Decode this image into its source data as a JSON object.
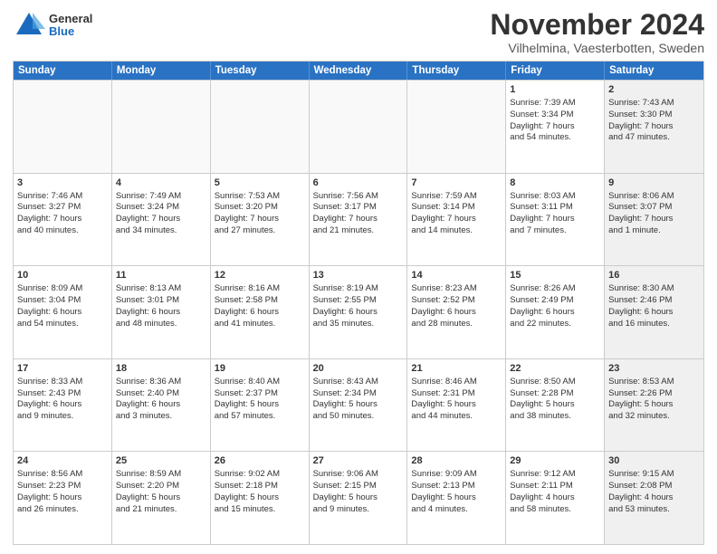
{
  "logo": {
    "general": "General",
    "blue": "Blue"
  },
  "header": {
    "month": "November 2024",
    "location": "Vilhelmina, Vaesterbotten, Sweden"
  },
  "days": [
    "Sunday",
    "Monday",
    "Tuesday",
    "Wednesday",
    "Thursday",
    "Friday",
    "Saturday"
  ],
  "rows": [
    [
      {
        "day": "",
        "empty": true
      },
      {
        "day": "",
        "empty": true
      },
      {
        "day": "",
        "empty": true
      },
      {
        "day": "",
        "empty": true
      },
      {
        "day": "",
        "empty": true
      },
      {
        "day": "1",
        "lines": [
          "Sunrise: 7:39 AM",
          "Sunset: 3:34 PM",
          "Daylight: 7 hours",
          "and 54 minutes."
        ]
      },
      {
        "day": "2",
        "shaded": true,
        "lines": [
          "Sunrise: 7:43 AM",
          "Sunset: 3:30 PM",
          "Daylight: 7 hours",
          "and 47 minutes."
        ]
      }
    ],
    [
      {
        "day": "3",
        "lines": [
          "Sunrise: 7:46 AM",
          "Sunset: 3:27 PM",
          "Daylight: 7 hours",
          "and 40 minutes."
        ]
      },
      {
        "day": "4",
        "lines": [
          "Sunrise: 7:49 AM",
          "Sunset: 3:24 PM",
          "Daylight: 7 hours",
          "and 34 minutes."
        ]
      },
      {
        "day": "5",
        "lines": [
          "Sunrise: 7:53 AM",
          "Sunset: 3:20 PM",
          "Daylight: 7 hours",
          "and 27 minutes."
        ]
      },
      {
        "day": "6",
        "lines": [
          "Sunrise: 7:56 AM",
          "Sunset: 3:17 PM",
          "Daylight: 7 hours",
          "and 21 minutes."
        ]
      },
      {
        "day": "7",
        "lines": [
          "Sunrise: 7:59 AM",
          "Sunset: 3:14 PM",
          "Daylight: 7 hours",
          "and 14 minutes."
        ]
      },
      {
        "day": "8",
        "lines": [
          "Sunrise: 8:03 AM",
          "Sunset: 3:11 PM",
          "Daylight: 7 hours",
          "and 7 minutes."
        ]
      },
      {
        "day": "9",
        "shaded": true,
        "lines": [
          "Sunrise: 8:06 AM",
          "Sunset: 3:07 PM",
          "Daylight: 7 hours",
          "and 1 minute."
        ]
      }
    ],
    [
      {
        "day": "10",
        "lines": [
          "Sunrise: 8:09 AM",
          "Sunset: 3:04 PM",
          "Daylight: 6 hours",
          "and 54 minutes."
        ]
      },
      {
        "day": "11",
        "lines": [
          "Sunrise: 8:13 AM",
          "Sunset: 3:01 PM",
          "Daylight: 6 hours",
          "and 48 minutes."
        ]
      },
      {
        "day": "12",
        "lines": [
          "Sunrise: 8:16 AM",
          "Sunset: 2:58 PM",
          "Daylight: 6 hours",
          "and 41 minutes."
        ]
      },
      {
        "day": "13",
        "lines": [
          "Sunrise: 8:19 AM",
          "Sunset: 2:55 PM",
          "Daylight: 6 hours",
          "and 35 minutes."
        ]
      },
      {
        "day": "14",
        "lines": [
          "Sunrise: 8:23 AM",
          "Sunset: 2:52 PM",
          "Daylight: 6 hours",
          "and 28 minutes."
        ]
      },
      {
        "day": "15",
        "lines": [
          "Sunrise: 8:26 AM",
          "Sunset: 2:49 PM",
          "Daylight: 6 hours",
          "and 22 minutes."
        ]
      },
      {
        "day": "16",
        "shaded": true,
        "lines": [
          "Sunrise: 8:30 AM",
          "Sunset: 2:46 PM",
          "Daylight: 6 hours",
          "and 16 minutes."
        ]
      }
    ],
    [
      {
        "day": "17",
        "lines": [
          "Sunrise: 8:33 AM",
          "Sunset: 2:43 PM",
          "Daylight: 6 hours",
          "and 9 minutes."
        ]
      },
      {
        "day": "18",
        "lines": [
          "Sunrise: 8:36 AM",
          "Sunset: 2:40 PM",
          "Daylight: 6 hours",
          "and 3 minutes."
        ]
      },
      {
        "day": "19",
        "lines": [
          "Sunrise: 8:40 AM",
          "Sunset: 2:37 PM",
          "Daylight: 5 hours",
          "and 57 minutes."
        ]
      },
      {
        "day": "20",
        "lines": [
          "Sunrise: 8:43 AM",
          "Sunset: 2:34 PM",
          "Daylight: 5 hours",
          "and 50 minutes."
        ]
      },
      {
        "day": "21",
        "lines": [
          "Sunrise: 8:46 AM",
          "Sunset: 2:31 PM",
          "Daylight: 5 hours",
          "and 44 minutes."
        ]
      },
      {
        "day": "22",
        "lines": [
          "Sunrise: 8:50 AM",
          "Sunset: 2:28 PM",
          "Daylight: 5 hours",
          "and 38 minutes."
        ]
      },
      {
        "day": "23",
        "shaded": true,
        "lines": [
          "Sunrise: 8:53 AM",
          "Sunset: 2:26 PM",
          "Daylight: 5 hours",
          "and 32 minutes."
        ]
      }
    ],
    [
      {
        "day": "24",
        "lines": [
          "Sunrise: 8:56 AM",
          "Sunset: 2:23 PM",
          "Daylight: 5 hours",
          "and 26 minutes."
        ]
      },
      {
        "day": "25",
        "lines": [
          "Sunrise: 8:59 AM",
          "Sunset: 2:20 PM",
          "Daylight: 5 hours",
          "and 21 minutes."
        ]
      },
      {
        "day": "26",
        "lines": [
          "Sunrise: 9:02 AM",
          "Sunset: 2:18 PM",
          "Daylight: 5 hours",
          "and 15 minutes."
        ]
      },
      {
        "day": "27",
        "lines": [
          "Sunrise: 9:06 AM",
          "Sunset: 2:15 PM",
          "Daylight: 5 hours",
          "and 9 minutes."
        ]
      },
      {
        "day": "28",
        "lines": [
          "Sunrise: 9:09 AM",
          "Sunset: 2:13 PM",
          "Daylight: 5 hours",
          "and 4 minutes."
        ]
      },
      {
        "day": "29",
        "lines": [
          "Sunrise: 9:12 AM",
          "Sunset: 2:11 PM",
          "Daylight: 4 hours",
          "and 58 minutes."
        ]
      },
      {
        "day": "30",
        "shaded": true,
        "lines": [
          "Sunrise: 9:15 AM",
          "Sunset: 2:08 PM",
          "Daylight: 4 hours",
          "and 53 minutes."
        ]
      }
    ]
  ]
}
